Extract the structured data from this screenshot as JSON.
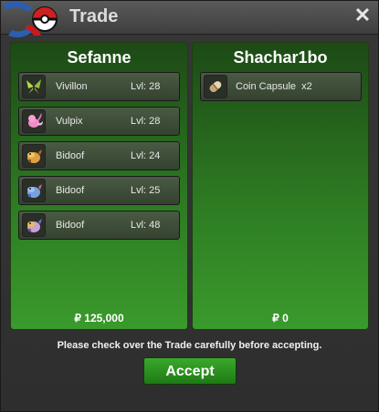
{
  "window": {
    "title": "Trade"
  },
  "left_panel": {
    "player": "Sefanne",
    "money": "₽ 125,000",
    "items": [
      {
        "name": "Vivillon",
        "level": "Lvl: 28",
        "icon": "vivillon-sprite-icon"
      },
      {
        "name": "Vulpix",
        "level": "Lvl: 28",
        "icon": "vulpix-sprite-icon"
      },
      {
        "name": "Bidoof",
        "level": "Lvl: 24",
        "icon": "bidoof-sprite-icon"
      },
      {
        "name": "Bidoof",
        "level": "Lvl: 25",
        "icon": "bidoof-sprite-icon"
      },
      {
        "name": "Bidoof",
        "level": "Lvl: 48",
        "icon": "bidoof-sprite-icon"
      }
    ]
  },
  "right_panel": {
    "player": "Shachar1bo",
    "money": "₽ 0",
    "items": [
      {
        "name": "Coin Capsule  x2",
        "icon": "coin-capsule-icon"
      }
    ]
  },
  "notice": "Please check over the Trade carefully before accepting.",
  "accept_label": "Accept",
  "colors": {
    "panel_green": "#2d7a22",
    "accept_green": "#3aa82b",
    "titlebar": "#4a4a4a"
  }
}
